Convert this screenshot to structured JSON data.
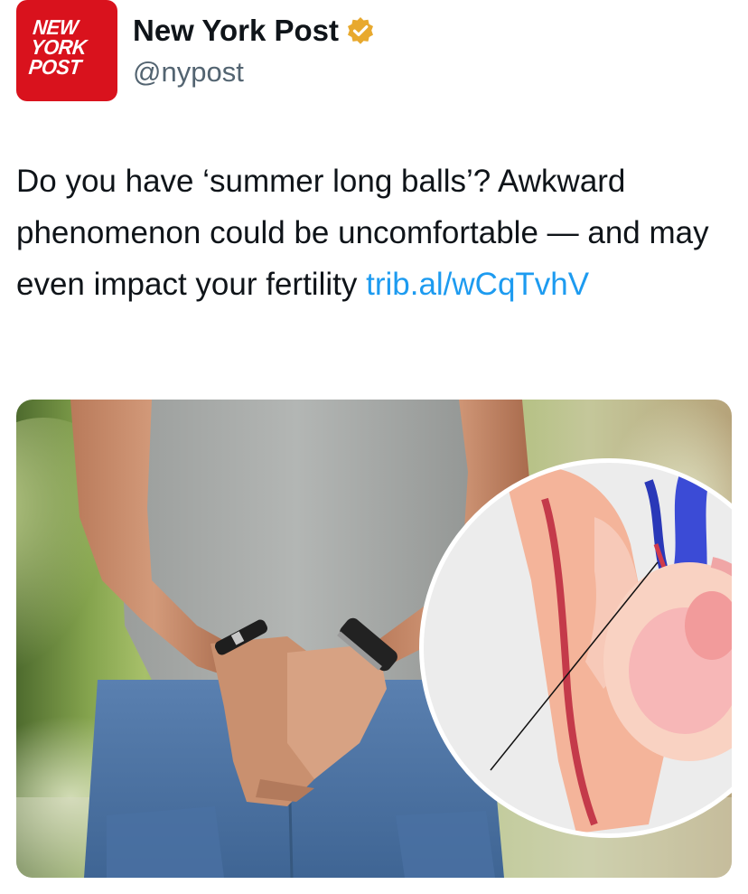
{
  "account": {
    "avatar_lines": [
      "NEW",
      "YORK",
      "POST"
    ],
    "display_name": "New York Post",
    "handle": "@nypost",
    "verified_color": "#e8a92e"
  },
  "tweet": {
    "text": "Do you have ‘summer long balls’? Awkward phenomenon could be uncomfortable — and may even impact your fertility ",
    "link_text": "trib.al/wCqTvhV"
  },
  "media": {
    "image": "photo of man in grey t-shirt and jeans with hands clasped in front, with inset anatomical illustration",
    "colors": {
      "brand_red": "#d9121d",
      "link_blue": "#1d9bf0",
      "shirt_grey": "#a7aaa8",
      "jeans_blue": "#5f86b8"
    }
  }
}
